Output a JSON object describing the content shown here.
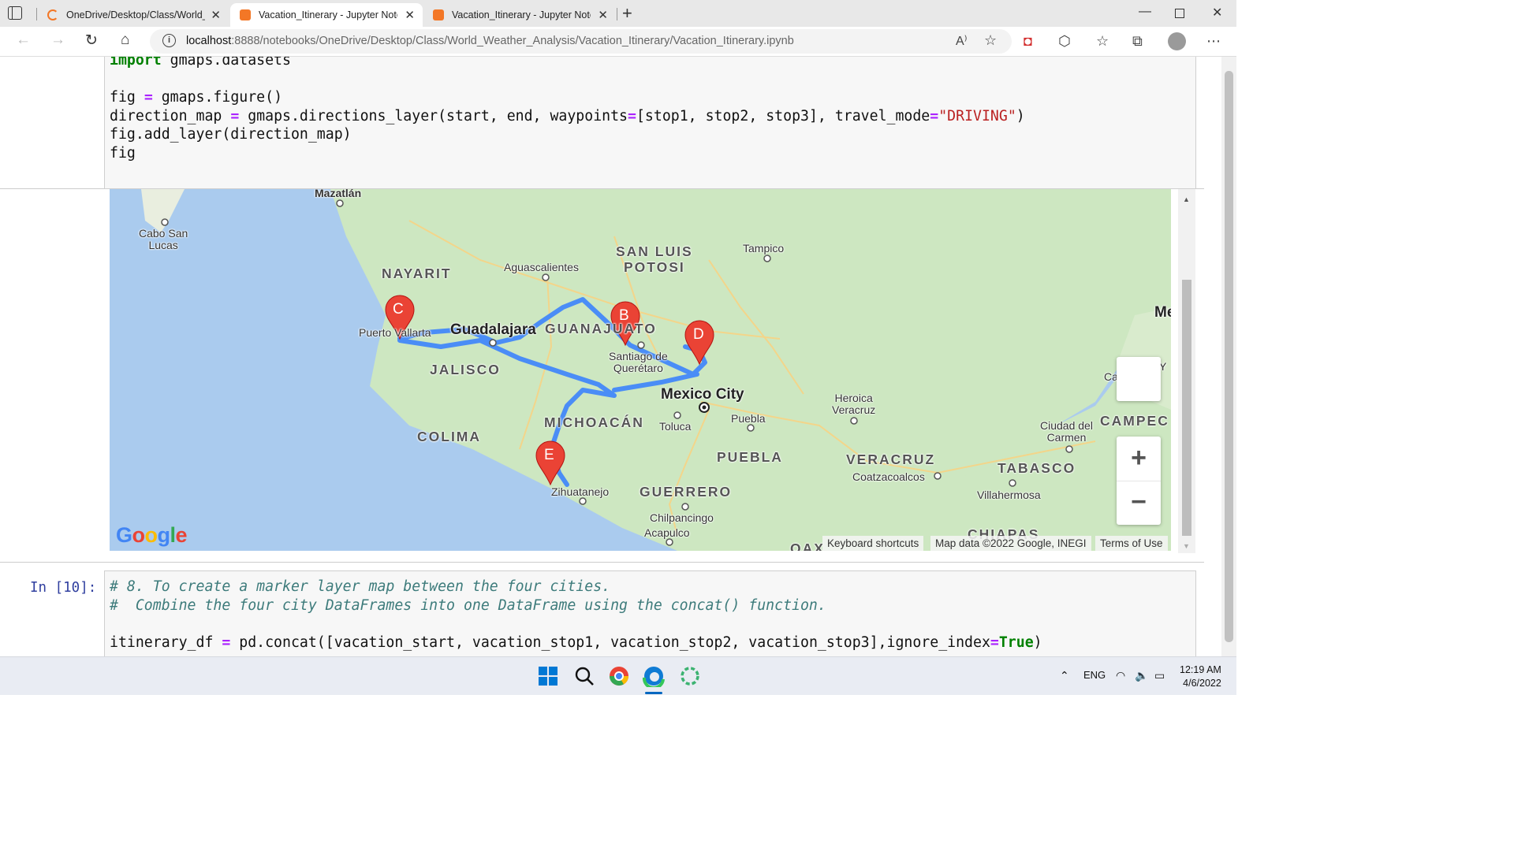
{
  "browser": {
    "tabs": [
      {
        "title": "OneDrive/Desktop/Class/World_",
        "active": false,
        "favicon": "jupyter-loading-icon"
      },
      {
        "title": "Vacation_Itinerary - Jupyter Note",
        "active": true,
        "favicon": "jupyter-notebook-icon"
      },
      {
        "title": "Vacation_Itinerary - Jupyter Note",
        "active": false,
        "favicon": "jupyter-notebook-icon"
      }
    ],
    "url_host": "localhost",
    "url_path": ":8888/notebooks/OneDrive/Desktop/Class/World_Weather_Analysis/Vacation_Itinerary/Vacation_Itinerary.ipynb"
  },
  "cell1": {
    "lines": [
      "import gmaps.datasets",
      "",
      "fig = gmaps.figure()",
      "direction_map = gmaps.directions_layer(start, end, waypoints=[stop1, stop2, stop3], travel_mode=\"DRIVING\")",
      "fig.add_layer(direction_map)",
      "fig"
    ]
  },
  "map": {
    "places": {
      "mazatlan": "Mazatlán",
      "cabo": "Cabo San\nLucas",
      "nayarit": "NAYARIT",
      "aguascalientes": "Aguascalientes",
      "san_luis": "SAN LUIS\nPOTOSI",
      "tampico": "Tampico",
      "puerto_vallarta": "Puerto Vallarta",
      "guadalajara": "Guadalajara",
      "guanajuato": "GUANAJUATO",
      "jalisco": "JALISCO",
      "queretaro": "Santiago de\nQuerétaro",
      "mexico_city": "Mexico City",
      "heroica": "Heroica\nVeracruz",
      "colima": "COLIMA",
      "michoacan": "MICHOACÁN",
      "toluca": "Toluca",
      "puebla_city": "Puebla",
      "puebla_state": "PUEBLA",
      "veracruz": "VERACRUZ",
      "coatzacoalcos": "Coatzacoalcos",
      "tabasco": "TABASCO",
      "villahermosa": "Villahermosa",
      "ciudad_carmen": "Ciudad del\nCarmen",
      "campeche": "CAMPEC",
      "zihuatanejo": "Zihuatanejo",
      "guerrero": "GUERRERO",
      "chilpancingo": "Chilpancingo",
      "acapulco": "Acapulco",
      "chiapas": "CHIAPAS",
      "oaxaca": "OAX",
      "ca": "Ca",
      "me": "Me",
      "y": "Y"
    },
    "markers": [
      "B",
      "C",
      "D",
      "E"
    ],
    "zoom_in": "+",
    "zoom_out": "−",
    "attribution": {
      "shortcuts": "Keyboard shortcuts",
      "data": "Map data ©2022 Google, INEGI",
      "terms": "Terms of Use"
    },
    "logo": "Google"
  },
  "cell2": {
    "prompt": "In [10]:",
    "comment1": "# 8. To create a marker layer map between the four cities.",
    "comment2": "#  Combine the four city DataFrames into one DataFrame using the concat() function.",
    "line": "itinerary_df = pd.concat([vacation_start, vacation_stop1, vacation_stop2, vacation_stop3],ignore_index=True)"
  },
  "taskbar": {
    "lang": "ENG",
    "time": "12:19 AM",
    "date": "4/6/2022"
  },
  "colors": {
    "route": "#4a8df6",
    "marker": "#ea4335",
    "water": "#aacbee",
    "land": "#cde7c1"
  }
}
